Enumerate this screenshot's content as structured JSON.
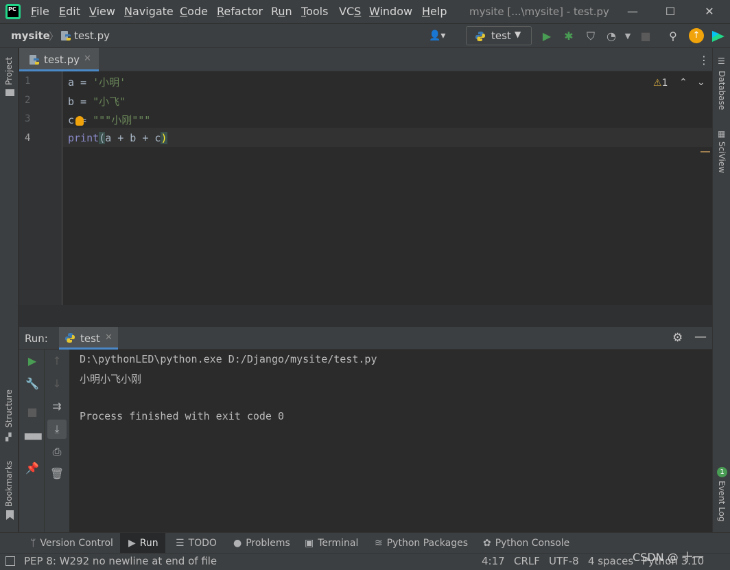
{
  "menu": {
    "items": [
      {
        "pre": "",
        "u": "F",
        "post": "ile"
      },
      {
        "pre": "",
        "u": "E",
        "post": "dit"
      },
      {
        "pre": "",
        "u": "V",
        "post": "iew"
      },
      {
        "pre": "",
        "u": "N",
        "post": "avigate"
      },
      {
        "pre": "",
        "u": "C",
        "post": "ode"
      },
      {
        "pre": "",
        "u": "R",
        "post": "efactor"
      },
      {
        "pre": "R",
        "u": "u",
        "post": "n"
      },
      {
        "pre": "",
        "u": "T",
        "post": "ools"
      },
      {
        "pre": "VC",
        "u": "S",
        "post": ""
      },
      {
        "pre": "",
        "u": "W",
        "post": "indow"
      },
      {
        "pre": "",
        "u": "H",
        "post": "elp"
      }
    ]
  },
  "window": {
    "title": "mysite [...\\mysite] - test.py",
    "minimize": "—",
    "maximize": "☐",
    "close": "✕"
  },
  "nav": {
    "project": "mysite",
    "separator": "〉",
    "file": "test.py",
    "run_config": "test"
  },
  "left_stripe": {
    "project": "Project",
    "structure": "Structure",
    "bookmarks": "Bookmarks"
  },
  "right_stripe": {
    "database": "Database",
    "sciview": "SciView",
    "event_log": "Event Log",
    "event_count": "1"
  },
  "editor": {
    "tab_label": "test.py",
    "warning_count": "1",
    "line_numbers": [
      "1",
      "2",
      "3",
      "4"
    ],
    "lines": [
      {
        "var": "a",
        "op": " = ",
        "str": "'小明'"
      },
      {
        "var": "b",
        "op": " = ",
        "str": "\"小飞\""
      },
      {
        "var": "c",
        "op": " = ",
        "str": "\"\"\"小刚\"\"\""
      },
      {
        "kw": "print",
        "open": "(",
        "args": "a + b + c",
        "close": ")"
      }
    ]
  },
  "run": {
    "title": "Run:",
    "tab_label": "test",
    "console": [
      "D:\\pythonLED\\python.exe D:/Django/mysite/test.py",
      "小明小飞小刚",
      "",
      "Process finished with exit code 0"
    ]
  },
  "bottom_tabs": [
    {
      "label": "Version Control",
      "icon": "branch-icon"
    },
    {
      "label": "Run",
      "icon": "play-icon"
    },
    {
      "label": "TODO",
      "icon": "list-icon"
    },
    {
      "label": "Problems",
      "icon": "info-icon"
    },
    {
      "label": "Terminal",
      "icon": "terminal-icon"
    },
    {
      "label": "Python Packages",
      "icon": "layers-icon"
    },
    {
      "label": "Python Console",
      "icon": "python-icon"
    }
  ],
  "status": {
    "message": "PEP 8: W292 no newline at end of file",
    "position": "4:17",
    "line_sep": "CRLF",
    "encoding": "UTF-8",
    "indent": "4 spaces",
    "interpreter": "Python 3.10"
  },
  "watermark": "CSDN @ 十一",
  "colors": {
    "accent": "#4a88c7",
    "run_green": "#499c54",
    "string": "#6a8759",
    "keyword": "#8888c6",
    "update_orange": "#f0a30a"
  }
}
